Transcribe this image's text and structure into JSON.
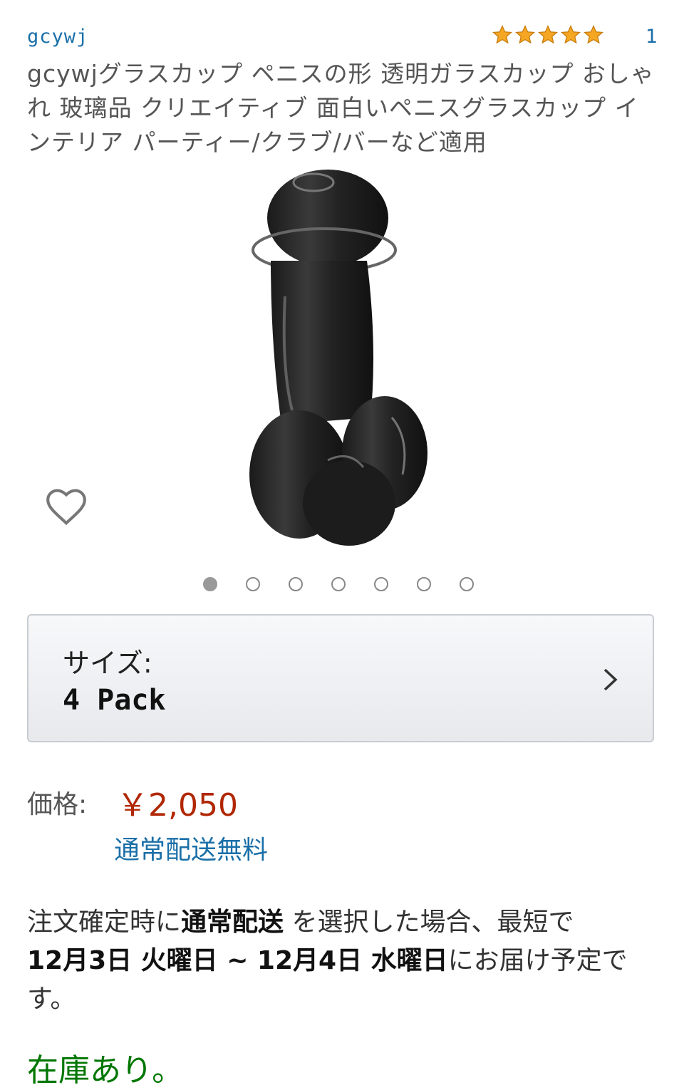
{
  "brand": "gcywj",
  "rating": {
    "stars": 5,
    "count": "1",
    "star_color": "#f5a623"
  },
  "title": "gcywjグラスカップ ペニスの形 透明ガラスカップ おしゃれ 玻璃品 クリエイティブ 面白いペニスグラスカップ インテリア パーティー/クラブ/バーなど適用",
  "carousel": {
    "total": 7,
    "active_index": 0
  },
  "size": {
    "label": "サイズ:",
    "value": "4 Pack"
  },
  "price": {
    "label": "価格:",
    "value": "￥2,050",
    "shipping": "通常配送無料"
  },
  "delivery": {
    "prefix": "注文確定時に",
    "method": "通常配送",
    "middle": " を選択した場合、最短で",
    "date_from": "12月3日 火曜日",
    "sep": " ~ ",
    "date_to": "12月4日 水曜日",
    "suffix": "にお届け予定です。"
  },
  "stock": "在庫あり。",
  "icons": {
    "wishlist": "heart-outline-icon",
    "chevron": "chevron-right-icon"
  }
}
